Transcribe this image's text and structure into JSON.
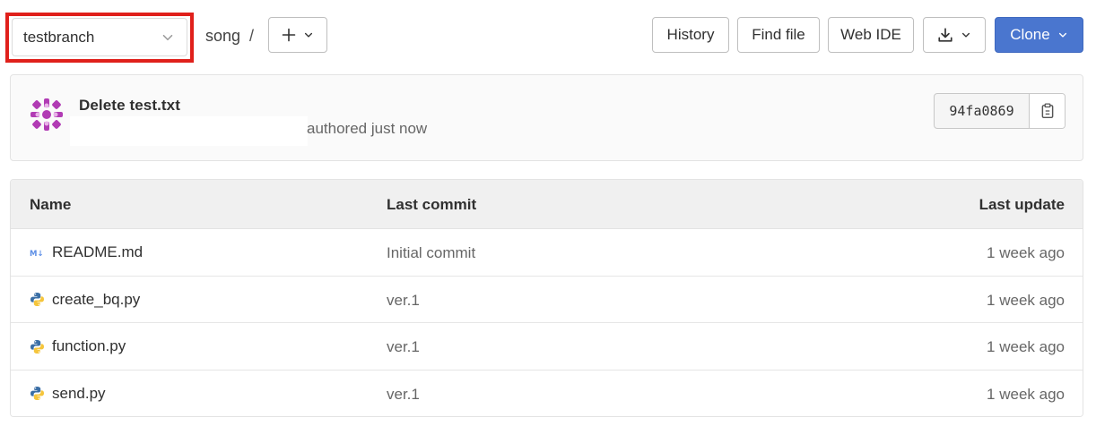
{
  "toolbar": {
    "branch": "testbranch",
    "path_root": "song",
    "path_separator": "/",
    "history_label": "History",
    "find_file_label": "Find file",
    "web_ide_label": "Web IDE",
    "clone_label": "Clone",
    "clone_color": "#4a76cf",
    "highlight_color": "#e0201b"
  },
  "commit": {
    "title": "Delete test.txt",
    "meta": "authored just now",
    "sha": "94fa0869"
  },
  "table": {
    "headers": {
      "name": "Name",
      "last_commit": "Last commit",
      "last_update": "Last update"
    },
    "rows": [
      {
        "name": "README.md",
        "icon": "markdown-icon",
        "last_commit": "Initial commit",
        "last_update": "1 week ago"
      },
      {
        "name": "create_bq.py",
        "icon": "python-icon",
        "last_commit": "ver.1",
        "last_update": "1 week ago"
      },
      {
        "name": "function.py",
        "icon": "python-icon",
        "last_commit": "ver.1",
        "last_update": "1 week ago"
      },
      {
        "name": "send.py",
        "icon": "python-icon",
        "last_commit": "ver.1",
        "last_update": "1 week ago"
      }
    ]
  }
}
